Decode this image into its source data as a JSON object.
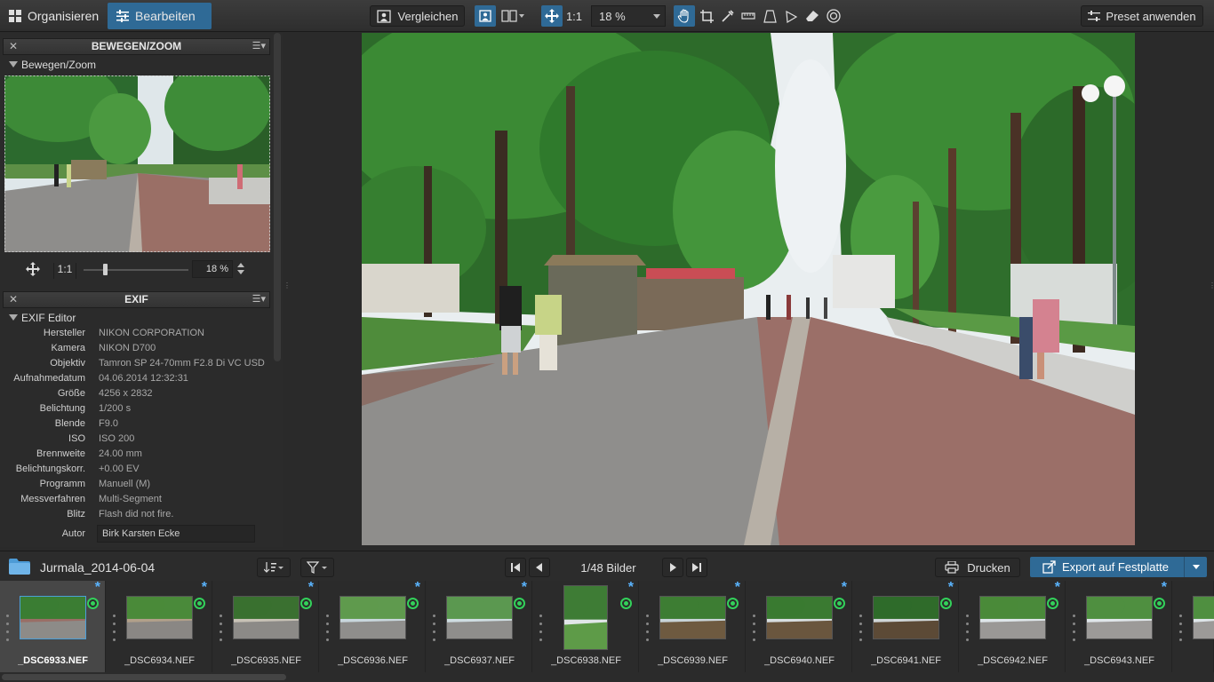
{
  "topbar": {
    "mode_organize": "Organisieren",
    "mode_edit": "Bearbeiten",
    "compare": "Vergleichen",
    "ratio": "1:1",
    "zoom": "18 %",
    "preset": "Preset anwenden"
  },
  "move_zoom": {
    "panel_title": "BEWEGEN/ZOOM",
    "section": "Bewegen/Zoom",
    "ratio": "1:1",
    "zoom_value": "18 %"
  },
  "exif": {
    "panel_title": "EXIF",
    "section": "EXIF Editor",
    "rows": [
      {
        "key": "Hersteller",
        "value": "NIKON CORPORATION"
      },
      {
        "key": "Kamera",
        "value": "NIKON D700"
      },
      {
        "key": "Objektiv",
        "value": "Tamron SP 24-70mm F2.8 Di VC USD"
      },
      {
        "key": "Aufnahmedatum",
        "value": "04.06.2014 12:32:31"
      },
      {
        "key": "Größe",
        "value": "4256 x 2832"
      },
      {
        "key": "Belichtung",
        "value": "1/200 s"
      },
      {
        "key": "Blende",
        "value": "F9.0"
      },
      {
        "key": "ISO",
        "value": "ISO 200"
      },
      {
        "key": "Brennweite",
        "value": "24.00 mm"
      },
      {
        "key": "Belichtungskorr.",
        "value": "+0.00 EV"
      },
      {
        "key": "Programm",
        "value": "Manuell (M)"
      },
      {
        "key": "Messverfahren",
        "value": "Multi-Segment"
      },
      {
        "key": "Blitz",
        "value": "Flash did not fire."
      }
    ],
    "author_label": "Autor",
    "author_value": "Birk Karsten Ecke"
  },
  "filmbar": {
    "folder": "Jurmala_2014-06-04",
    "pager": "1/48 Bilder",
    "print": "Drucken",
    "export": "Export auf Festplatte"
  },
  "thumbnails": [
    {
      "name": "_DSC6933.NEF"
    },
    {
      "name": "_DSC6934.NEF"
    },
    {
      "name": "_DSC6935.NEF"
    },
    {
      "name": "_DSC6936.NEF"
    },
    {
      "name": "_DSC6937.NEF"
    },
    {
      "name": "_DSC6938.NEF"
    },
    {
      "name": "_DSC6939.NEF"
    },
    {
      "name": "_DSC6940.NEF"
    },
    {
      "name": "_DSC6941.NEF"
    },
    {
      "name": "_DSC6942.NEF"
    },
    {
      "name": "_DSC6943.NEF"
    }
  ],
  "icons": {
    "grid": "grid-icon",
    "sliders": "sliders-icon",
    "hand": "hand-tool-icon",
    "crop": "crop-icon",
    "folder": "folder-icon",
    "printer": "printer-icon",
    "export": "export-icon"
  },
  "colors": {
    "accent": "#2f6a96",
    "star": "#5ab4ff",
    "status_green": "#33d15a"
  }
}
